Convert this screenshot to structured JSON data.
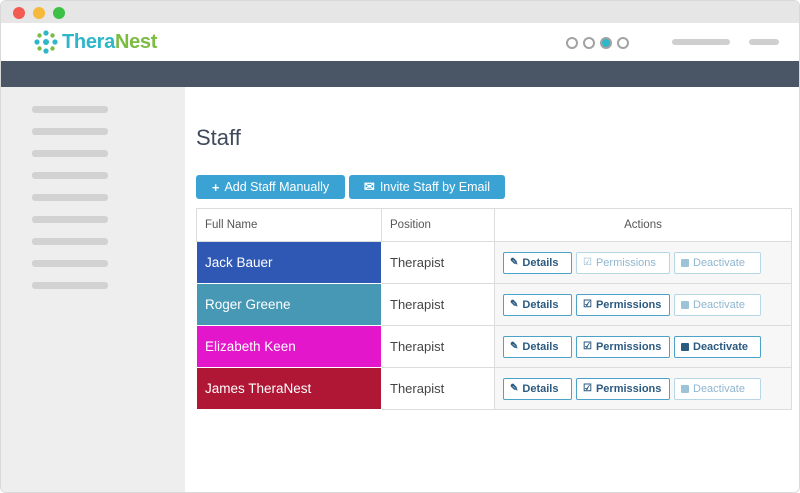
{
  "app": {
    "logo_part1": "Thera",
    "logo_part2": "Nest",
    "colors": {
      "teal": "#2db7c8",
      "green": "#7cbc43",
      "navbar": "#4a5565",
      "button": "#3aa3d3"
    },
    "header_icons": [
      "circle-icon",
      "circle-icon",
      "chat-icon",
      "circle-icon"
    ]
  },
  "page": {
    "title": "Staff",
    "add_button": {
      "icon": "+",
      "label": "Add Staff Manually"
    },
    "invite_button": {
      "icon": "✉",
      "label": "Invite Staff by Email"
    }
  },
  "table": {
    "headers": [
      "Full Name",
      "Position",
      "Actions"
    ],
    "action_labels": {
      "details": "Details",
      "permissions": "Permissions",
      "deactivate": "Deactivate"
    },
    "rows": [
      {
        "name": "Jack Bauer",
        "position": "Therapist",
        "color": "#2f58b4",
        "permissions_enabled": false,
        "deactivate_enabled": false
      },
      {
        "name": "Roger Greene",
        "position": "Therapist",
        "color": "#4698b5",
        "permissions_enabled": true,
        "deactivate_enabled": false
      },
      {
        "name": "Elizabeth Keen",
        "position": "Therapist",
        "color": "#e316cc",
        "permissions_enabled": true,
        "deactivate_enabled": true
      },
      {
        "name": "James TheraNest",
        "position": "Therapist",
        "color": "#b01735",
        "permissions_enabled": true,
        "deactivate_enabled": false
      }
    ]
  }
}
